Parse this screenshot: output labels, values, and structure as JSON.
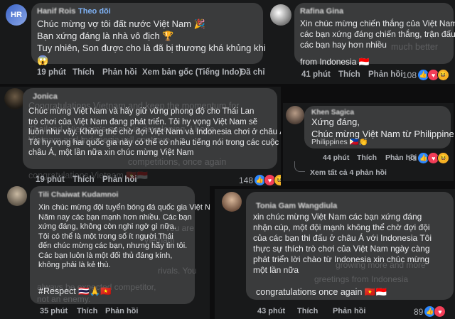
{
  "c1": {
    "author": "Hanif Rois",
    "follow": "Theo dõi",
    "lines": [
      "Chúc mừng vợ tôi đất nước Việt Nam 🎉",
      "Bạn xứng đáng là nhà vô địch 🏆",
      "Tuy nhiên, Son được cho là đã bị thương khá khủng khiếp",
      "😱"
    ],
    "time": "19 phút",
    "like": "Thích",
    "reply": "Phản hồi",
    "view_original": "Xem bản gốc (Tiếng Indo)",
    "translated": "Đã chỉ sửa"
  },
  "c2": {
    "author": "Rafina Gina",
    "lines": [
      "Xin chúc mừng chiến thắng của Việt Nam,",
      "các bạn xứng đáng chiến thắng, trận đấu của",
      "các bạn hay hơn nhiều",
      "from Indonesia 🇮🇩"
    ],
    "ghost": "much better",
    "time": "41 phút",
    "like": "Thích",
    "reply": "Phản hồi",
    "count": "108"
  },
  "c3": {
    "author": "Jonica",
    "lines": [
      "Chúc mừng Việt Nam và hãy giữ vững phong độ cho Thái Lan",
      "trò chơi của Việt Nam đang phát triển. Tôi hy vọng Việt Nam sẽ",
      "luôn như vậy. Không thể chờ đợi Việt Nam và Indonesia chơi ở châu Á.",
      "Tôi hy vọng hai quốc gia này có thể có nhiều tiếng nói trong các cuộc thi",
      "châu Á, một lần nữa xin chúc mừng Việt Nam"
    ],
    "ghosts": [
      "Congratulations Vietnam and keep the momentum for",
      "Thailand, Vietnam's game is developing. I hope",
      "Vietnam and Indonesia will continue",
      "competitions, once again",
      "congratulations Vietnam 🇻🇳🇮🇩"
    ],
    "time": "19 phút",
    "like": "Thích",
    "reply": "Phản hồi",
    "count": "148"
  },
  "c4": {
    "author": "Khen Sagica",
    "lines": [
      "Xứng đáng,",
      "Chúc mừng Việt Nam từ Philippines"
    ],
    "sub": "Philippines 🇵🇭👏",
    "time": "44 phút",
    "like": "Thích",
    "reply": "Phản hồi",
    "count": "91",
    "view_replies": "Xem tất cả 4 phản hồi"
  },
  "c5": {
    "author": "Tili Chaiwat Kudamnoi",
    "lines": [
      "Xin chúc mừng đội tuyển bóng đá quốc gia Việt Nam",
      "Năm nay các bạn mạnh hơn nhiều. Các bạn",
      "xứng đáng, không còn nghi ngờ gì nữa.",
      "Tôi có thể là một trong số ít người Thái",
      "đến chúc mừng các bạn, nhưng hãy tin tôi.",
      "Các bạn luôn là một đối thủ đáng kính,",
      "không phải là kẻ thù."
    ],
    "ghosts": [
      "You are",
      "Vietnam",
      "rivals. You",
      "always be expected competitor,",
      "not an enemy."
    ],
    "hashtag": "#Respect 🇹🇭🙏🇻🇳",
    "time": "35 phút",
    "like": "Thích",
    "reply": "Phản hồi"
  },
  "c6": {
    "author": "Tonia Gam Wangdiula",
    "lines": [
      "xin chúc mừng Việt Nam các bạn xứng đáng",
      "nhận cúp, một đội mạnh không thể chờ đợi đội",
      "của các bạn thi đấu ở châu Á với Indonesia Tôi",
      "thực sự thích trò chơi của Việt Nam ngày càng",
      "phát triển lời chào từ Indonesia xin chúc mừng",
      "một lần nữa"
    ],
    "ghosts": [
      "growing more and more",
      "greetings from Indonesia"
    ],
    "closing": "congratulations once again 🇻🇳🇮🇩",
    "time": "43 phút",
    "like": "Thích",
    "reply": "Phản hồi",
    "count": "89"
  }
}
